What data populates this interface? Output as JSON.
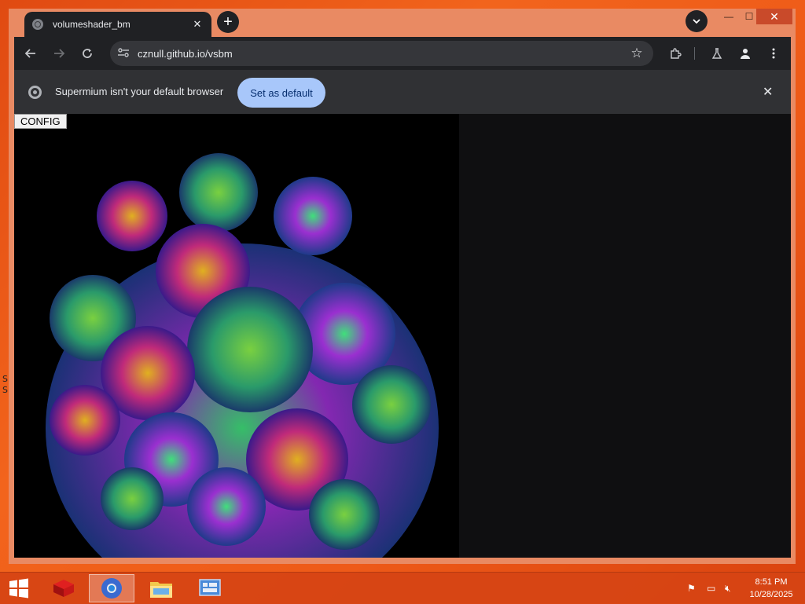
{
  "desktop": {
    "fragments": [
      "S",
      "S"
    ]
  },
  "tab": {
    "title": "volumeshader_bm",
    "close_glyph": "✕"
  },
  "new_tab_glyph": "+",
  "window_controls": {
    "minimize": "—",
    "maximize": "☐",
    "close": "✕"
  },
  "toolbar": {
    "url": "cznull.github.io/vsbm"
  },
  "infobar": {
    "message": "Supermium isn't your default browser",
    "button": "Set as default"
  },
  "page": {
    "config_button": "CONFIG"
  },
  "taskbar": {
    "time": "8:51 PM",
    "date": "10/28/2025"
  },
  "colors": {
    "chrome_dark": "#202124",
    "infobar": "#303134",
    "accent_button": "#a8c7fa",
    "desktop": "#e85a1a"
  },
  "icons": [
    "globe-icon",
    "close-icon",
    "plus-icon",
    "chevron-down-icon",
    "back-arrow-icon",
    "forward-arrow-icon",
    "reload-icon",
    "site-settings-icon",
    "star-icon",
    "extensions-icon",
    "labs-flask-icon",
    "profile-icon",
    "kebab-menu-icon",
    "chrome-logo-icon",
    "windows-start-icon",
    "network-icon",
    "volume-muted-icon",
    "flag-icon"
  ]
}
